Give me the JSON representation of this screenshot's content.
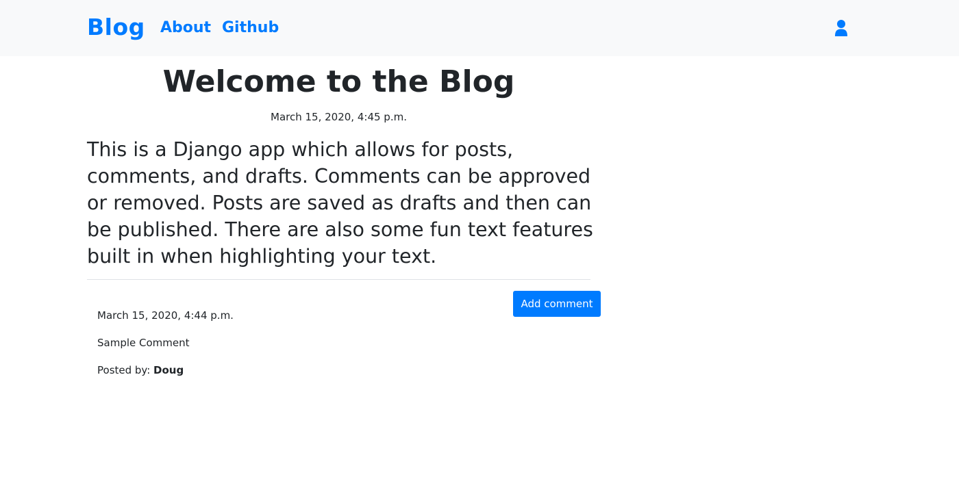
{
  "navbar": {
    "brand": "Blog",
    "links": [
      {
        "label": "About"
      },
      {
        "label": "Github"
      }
    ],
    "user_icon": "user-icon"
  },
  "post": {
    "title": "Welcome to the Blog",
    "date": "March 15, 2020, 4:45 p.m.",
    "body": "This is a Django app which allows for posts, comments, and drafts. Comments can be approved or removed. Posts are saved as drafts and then can be published. There are also some fun text features built in when highlighting your text."
  },
  "comments_section": {
    "add_comment_label": "Add comment",
    "comments": [
      {
        "date": "March 15, 2020, 4:44 p.m.",
        "text": "Sample Comment",
        "posted_by_label": "Posted by:",
        "author": "Doug"
      }
    ]
  },
  "colors": {
    "accent": "#007bff",
    "navbar_bg": "#f8f9fa",
    "text": "#212529",
    "divider": "#dee2e6"
  }
}
